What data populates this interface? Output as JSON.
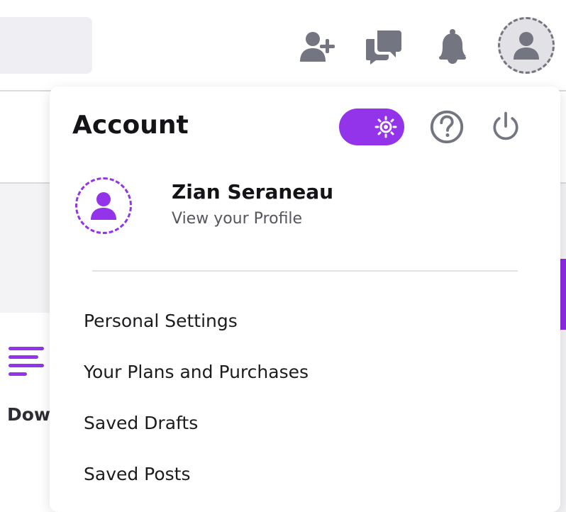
{
  "header": {
    "icons": [
      "add-user-icon",
      "chat-icon",
      "bell-icon",
      "user-avatar-icon"
    ]
  },
  "background": {
    "partial_label": "Dow"
  },
  "account_menu": {
    "title": "Account",
    "theme_toggle_icon": "sun-icon",
    "help_icon": "question-circle-icon",
    "logout_icon": "power-icon",
    "user": {
      "name": "Zian Seraneau",
      "link": "View your Profile"
    },
    "items": [
      {
        "label": "Personal Settings"
      },
      {
        "label": "Your Plans and Purchases"
      },
      {
        "label": "Saved Drafts"
      },
      {
        "label": "Saved Posts"
      }
    ]
  },
  "colors": {
    "accent": "#9333ea",
    "icon_gray": "#737580"
  }
}
